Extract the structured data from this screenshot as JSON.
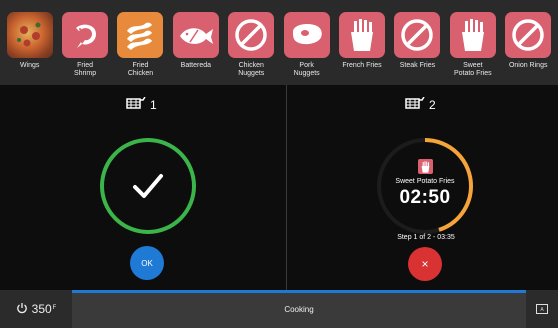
{
  "menu": {
    "items": [
      {
        "label": "Wings",
        "icon": "pizza-icon"
      },
      {
        "label": "Fried\nShrimp",
        "icon": "shrimp-icon"
      },
      {
        "label": "Fried\nChicken",
        "icon": "chicken-strips-icon"
      },
      {
        "label": "Battereda",
        "icon": "fish-icon"
      },
      {
        "label": "Chicken\nNuggets",
        "icon": "prohibited-icon"
      },
      {
        "label": "Pork\nNuggets",
        "icon": "pork-icon"
      },
      {
        "label": "French Fries",
        "icon": "fries-icon"
      },
      {
        "label": "Steak Fries",
        "icon": "prohibited-icon"
      },
      {
        "label": "Sweet\nPotato Fries",
        "icon": "fries-icon"
      },
      {
        "label": "Onion Rings",
        "icon": "prohibited-icon"
      }
    ]
  },
  "baskets": {
    "left": {
      "number": "1",
      "state": "done",
      "ok_label": "OK"
    },
    "right": {
      "number": "2",
      "product": "Sweet Potato Fries",
      "timer": "02:50",
      "step": "Step 1 of 2 - 03:35",
      "progress_fraction": 0.45,
      "cancel_label": "×"
    }
  },
  "bottom": {
    "temperature": "350",
    "unit_mark": "F",
    "status": "Cooking"
  },
  "colors": {
    "pink_tile": "#d9606f",
    "orange_tile": "#e88a3c",
    "done_ring": "#3bb54a",
    "timer_ring": "#f5a43a",
    "ok_blue": "#1f7ad6",
    "cancel_red": "#d93232"
  }
}
